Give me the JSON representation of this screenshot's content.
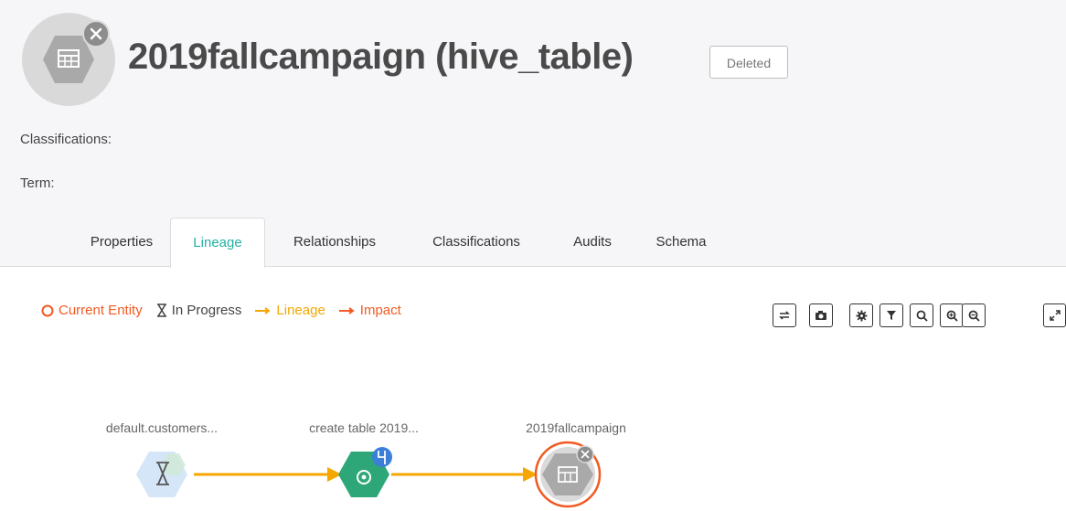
{
  "entity": {
    "title": "2019fallcampaign (hive_table)",
    "status_badge": "Deleted"
  },
  "meta": {
    "classifications_label": "Classifications:",
    "term_label": "Term:"
  },
  "tabs": [
    {
      "label": "Properties",
      "active": false
    },
    {
      "label": "Lineage",
      "active": true
    },
    {
      "label": "Relationships",
      "active": false
    },
    {
      "label": "Classifications",
      "active": false
    },
    {
      "label": "Audits",
      "active": false
    },
    {
      "label": "Schema",
      "active": false
    }
  ],
  "legend": {
    "current_entity": "Current Entity",
    "in_progress": "In Progress",
    "lineage": "Lineage",
    "impact": "Impact"
  },
  "toolbar_icons": [
    "realign-icon",
    "camera-icon",
    "gear-icon",
    "filter-icon",
    "search-icon",
    "zoom-in-icon",
    "zoom-out-icon",
    "fullscreen-icon"
  ],
  "lineage_nodes": [
    {
      "label": "default.customers...",
      "icon": "hourglass-icon"
    },
    {
      "label": "create table 2019...",
      "icon": "process-gear-icon"
    },
    {
      "label": "2019fallcampaign",
      "icon": "table-icon"
    }
  ],
  "colors": {
    "accent": "#23b0a3",
    "current_entity": "#f15a22",
    "lineage": "#f5a700",
    "impact": "#f15a22"
  }
}
